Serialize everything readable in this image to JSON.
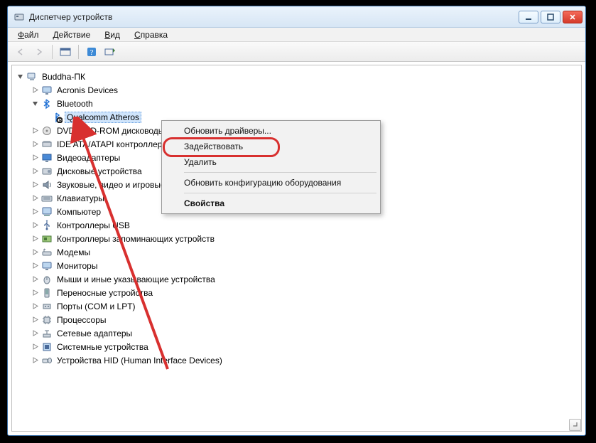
{
  "window": {
    "title": "Диспетчер устройств"
  },
  "menu": {
    "file": "Файл",
    "action": "Действие",
    "view": "Вид",
    "help": "Справка"
  },
  "tree": {
    "root": "Buddha-ПК",
    "nodes": [
      {
        "label": "Acronis Devices",
        "icon": "monitor"
      },
      {
        "label": "Bluetooth",
        "icon": "bluetooth",
        "expanded": true,
        "children": [
          {
            "label": "Qualcomm Atheros",
            "icon": "bluetooth-disabled",
            "selected": true
          }
        ]
      },
      {
        "label": "DVD и CD-ROM дисководы",
        "icon": "optical",
        "truncated": "D    и CD-ROM диско"
      },
      {
        "label": "IDE ATA/ATAPI контроллеры",
        "icon": "ide",
        "truncated": "IDE ATA/ATAPI контр"
      },
      {
        "label": "Видеоадаптеры",
        "icon": "display",
        "truncated": "Видеоадаптеры"
      },
      {
        "label": "Дисковые устройства",
        "icon": "disk",
        "truncated": "Дисковые устройства"
      },
      {
        "label": "Звуковые, видео и игровые устройства",
        "icon": "sound",
        "truncated": "Звуковые, видео и игр"
      },
      {
        "label": "Клавиатуры",
        "icon": "keyboard",
        "truncated": "Клавиатуры"
      },
      {
        "label": "Компьютер",
        "icon": "computer",
        "truncated": "Компьютер"
      },
      {
        "label": "Контроллеры USB",
        "icon": "usb"
      },
      {
        "label": "Контроллеры запоминающих устройств",
        "icon": "storage"
      },
      {
        "label": "Модемы",
        "icon": "modem"
      },
      {
        "label": "Мониторы",
        "icon": "monitor2"
      },
      {
        "label": "Мыши и иные указывающие устройства",
        "icon": "mouse",
        "truncated": "Мыши и иные указывающие устройства"
      },
      {
        "label": "Переносные устройства",
        "icon": "portable",
        "truncated": "Переносные устройства"
      },
      {
        "label": "Порты (COM и LPT)",
        "icon": "ports",
        "truncated": "Порты (COM и LPT)"
      },
      {
        "label": "Процессоры",
        "icon": "cpu"
      },
      {
        "label": "Сетевые адаптеры",
        "icon": "network",
        "truncated": "Сетевые адаптеры"
      },
      {
        "label": "Системные устройства",
        "icon": "system",
        "truncated": "Системные устройства"
      },
      {
        "label": "Устройства HID (Human Interface Devices)",
        "icon": "hid",
        "truncated": "Устройства HID (Human Interface Devices)"
      }
    ]
  },
  "context_menu": {
    "items": [
      {
        "label": "Обновить драйверы..."
      },
      {
        "label": "Задействовать",
        "highlighted": true
      },
      {
        "label": "Удалить"
      },
      {
        "sep": true
      },
      {
        "label": "Обновить конфигурацию оборудования"
      },
      {
        "sep": true
      },
      {
        "label": "Свойства",
        "bold": true
      }
    ]
  }
}
